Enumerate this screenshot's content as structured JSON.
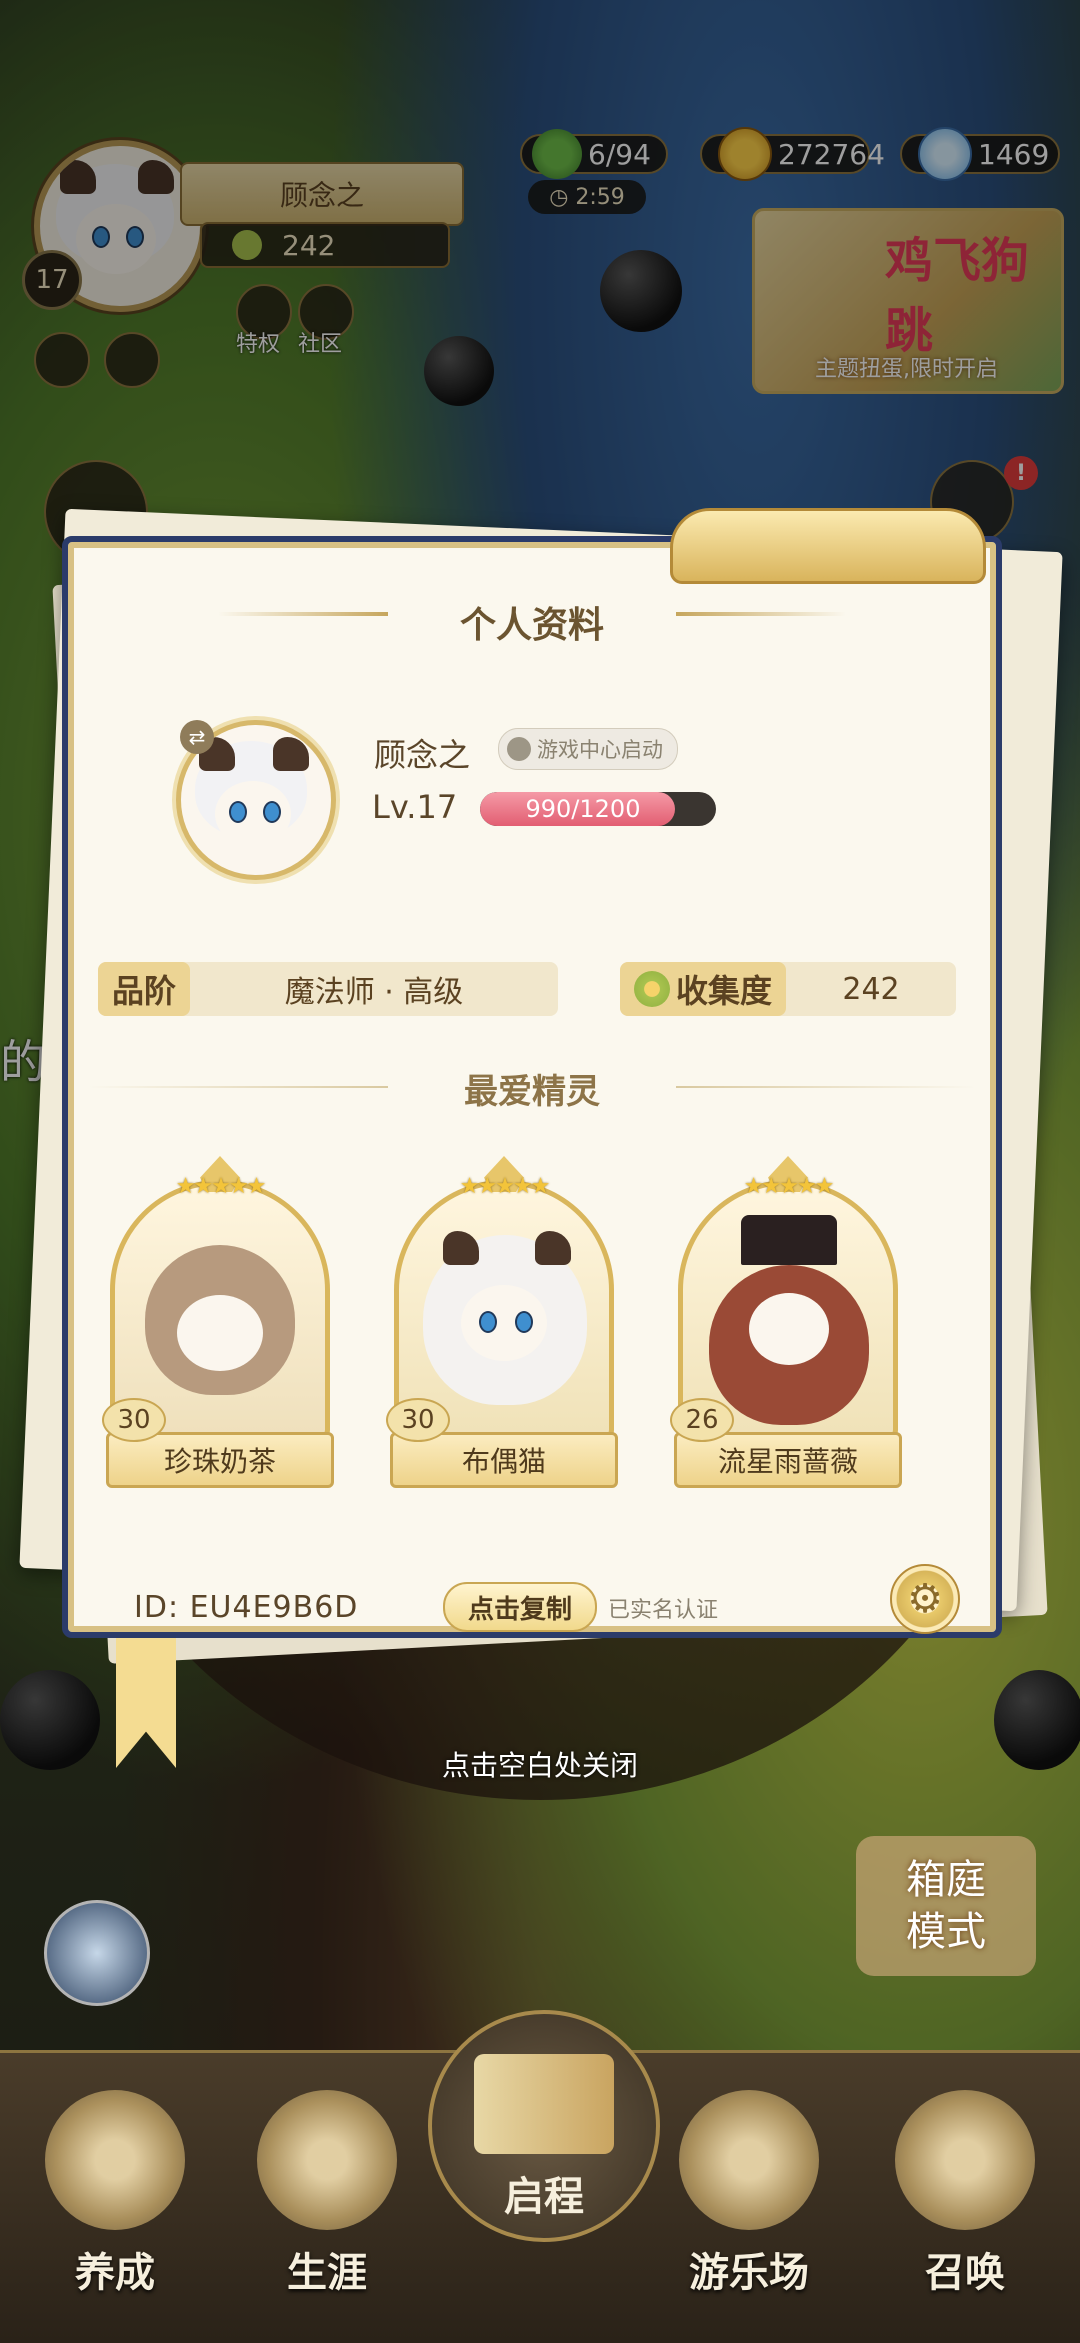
{
  "hud": {
    "player_name": "顾念之",
    "level": "17",
    "collection": "242",
    "clover_count": "6/94",
    "timer": "2:59",
    "gold": "272764",
    "diamonds": "1469",
    "privilege_label": "特权",
    "community_label": "社区",
    "event_banner_title": "鸡飞狗跳",
    "event_banner_subtitle": "主题扭蛋,限时开启",
    "mail_badge": "!",
    "side_text": "的橘"
  },
  "profile": {
    "title": "个人资料",
    "name": "顾念之",
    "tag": "游戏中心启动",
    "level_label": "Lv.17",
    "xp_text": "990/1200",
    "xp_fraction": 0.825,
    "rank_label": "品阶",
    "rank_value": "魔法师 · 高级",
    "collection_label": "收集度",
    "collection_value": "242",
    "favorites_title": "最爱精灵",
    "favorites": [
      {
        "name": "珍珠奶茶",
        "level": "30",
        "stars": "★★★★★"
      },
      {
        "name": "布偶猫",
        "level": "30",
        "stars": "★★★★★"
      },
      {
        "name": "流星雨蔷薇",
        "level": "26",
        "stars": "★★★★★"
      }
    ],
    "id_label": "ID:  EU4E9B6D",
    "copy_button": "点击复制",
    "verified_text": "已实名认证"
  },
  "close_tip": "点击空白处关闭",
  "box_mode": {
    "line1": "箱庭",
    "line2": "模式"
  },
  "nav": {
    "items": [
      "养成",
      "生涯",
      "启程",
      "游乐场",
      "召唤"
    ]
  }
}
